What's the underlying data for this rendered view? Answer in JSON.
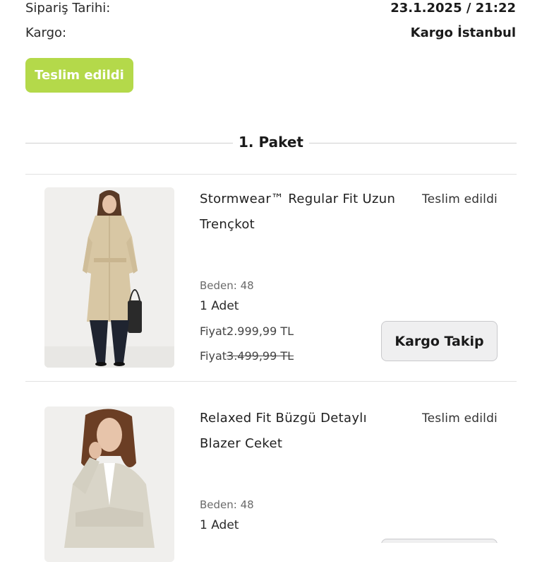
{
  "order": {
    "date_label": "Sipariş Tarihi:",
    "date_value": "23.1.2025 / 21:22",
    "cargo_label": "Kargo:",
    "cargo_value": "Kargo İstanbul",
    "status": "Teslim edildi",
    "status_color": "#b4d94a"
  },
  "package": {
    "title": "1. Paket"
  },
  "items": [
    {
      "name_line1": "Stormwear™ Regular Fit Uzun",
      "name_line2": "Trençkot",
      "status": "Teslim edildi",
      "size_label": "Beden:",
      "size_value": "48",
      "quantity": "1 Adet",
      "price_label": "Fiyat",
      "price": "2.999,99 TL",
      "old_price_label": "Fiyat",
      "old_price": "3.499,99 TL",
      "track_button": "Kargo Takip",
      "image_icon": "trench-coat-product-photo"
    },
    {
      "name_line1": "Relaxed Fit Büzgü Detaylı",
      "name_line2": "Blazer Ceket",
      "status": "Teslim edildi",
      "size_label": "Beden:",
      "size_value": "48",
      "quantity": "1 Adet",
      "image_icon": "blazer-product-photo"
    }
  ]
}
